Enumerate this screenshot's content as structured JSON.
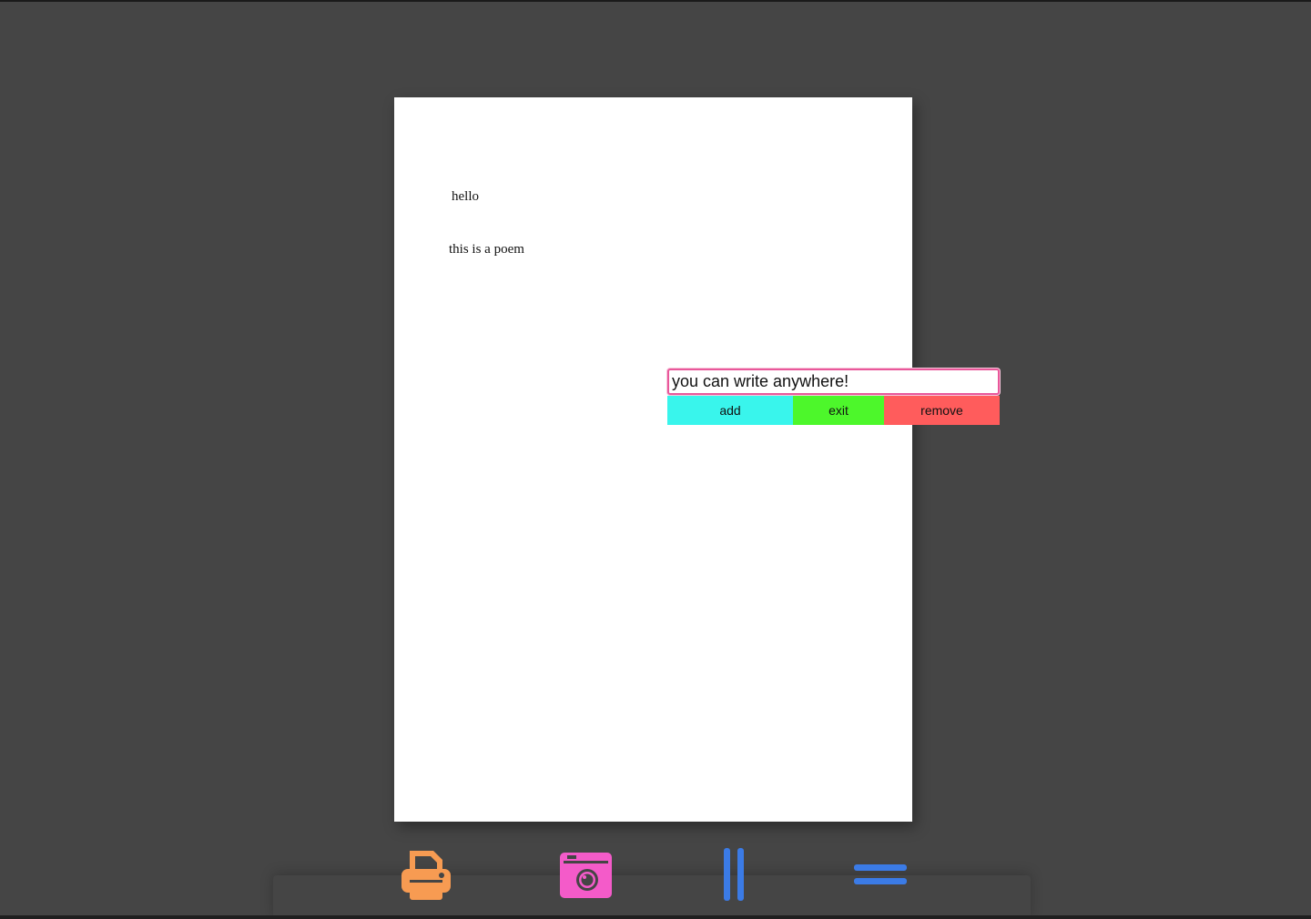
{
  "document": {
    "lines": [
      "hello",
      "this is a poem"
    ]
  },
  "editor": {
    "input_value": "you can write anywhere!",
    "add_label": "add",
    "exit_label": "exit",
    "remove_label": "remove"
  },
  "toolbar": {
    "items": [
      {
        "icon": "printer-icon",
        "color": "#f79b52"
      },
      {
        "icon": "camera-icon",
        "color": "#f45bc9"
      },
      {
        "icon": "columns-icon",
        "color": "#3b7be6"
      },
      {
        "icon": "menu-icon",
        "color": "#3b7be6"
      }
    ]
  },
  "colors": {
    "background": "#454545",
    "page": "#ffffff",
    "input_border": "#e9579a",
    "add": "#39f5ec",
    "exit": "#4df72b",
    "remove": "#ff5c5c"
  }
}
